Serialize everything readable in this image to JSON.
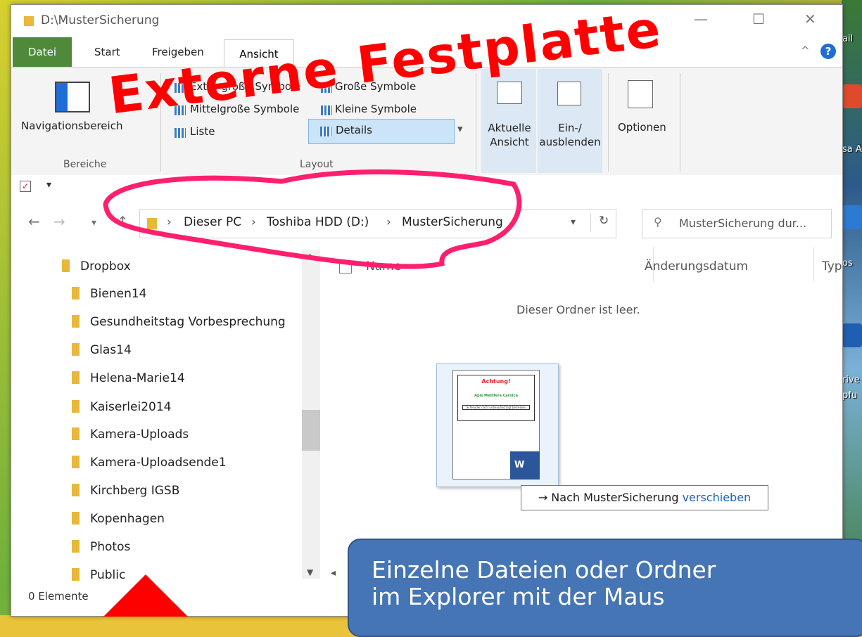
{
  "window": {
    "title": "D:\\MusterSicherung",
    "controls": [
      "—",
      "☐",
      "✕"
    ]
  },
  "desktop": {
    "labels": [
      "ail",
      "sa Ä",
      "rive",
      "pfu",
      "os"
    ]
  },
  "ribbon": {
    "tabs": {
      "file": "Datei",
      "start": "Start",
      "share": "Freigeben",
      "view": "Ansicht"
    },
    "panes": {
      "nav_pane": "Navigationsbereich",
      "group": "Bereiche"
    },
    "layout": {
      "extra_large": "Extra große Symbole",
      "large": "Große Symbole",
      "medium": "Mittelgroße Symbole",
      "small": "Kleine Symbole",
      "list": "Liste",
      "details": "Details",
      "group": "Layout"
    },
    "current_view": "Aktuelle\nAnsicht",
    "show_hide": "Ein-/\nausblenden",
    "options": "Optionen"
  },
  "address": {
    "crumbs": [
      "Dieser PC",
      "Toshiba HDD (D:)",
      "MusterSicherung"
    ],
    "search_placeholder": "MusterSicherung dur..."
  },
  "sidebar": {
    "items": [
      "Dropbox",
      "Bienen14",
      "Gesundheitstag Vorbesprechung",
      "Glas14",
      "Helena-Marie14",
      "Kaiserlei2014",
      "Kamera-Uploads",
      "Kamera-Uploadsende1",
      "Kirchberg IGSB",
      "Kopenhagen",
      "Photos",
      "Public"
    ]
  },
  "columns": {
    "name": "Name",
    "date": "Änderungsdatum",
    "type": "Typ"
  },
  "content": {
    "empty": "Dieser Ordner ist leer.",
    "doc_title": "Achtung!",
    "doc_subtitle": "Apis Mellifera Carnica",
    "doc_line": "Schleuder nicht unbeaufsichtigt betreiben",
    "doc_badge": "W",
    "drop_tip_prefix": "→ Nach MusterSicherung",
    "drop_tip_action": "verschieben"
  },
  "status": {
    "count": "0 Elemente"
  },
  "overlay": {
    "title": "Externe Festplatte",
    "callout_line1": "Einzelne Dateien oder Ordner",
    "callout_line2": "im Explorer mit der Maus"
  }
}
